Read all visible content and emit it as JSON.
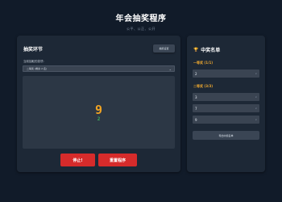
{
  "header": {
    "title": "年会抽奖程序",
    "subtitle": "公平、公正、公开"
  },
  "lottery": {
    "title": "抽奖环节",
    "settings_label": "抽奖设置",
    "prize_field_label": "当前抽取的奖项:",
    "prize_selected": "二等奖 (剩余 2 名)",
    "rolling_number": "9",
    "previous_number": "2",
    "stop_label": "停止!",
    "reset_label": "重置程序"
  },
  "winners": {
    "title": "中奖名单",
    "icon": "trophy-icon",
    "groups": [
      {
        "name": "一等奖 (1/1)",
        "entries": [
          "2"
        ]
      },
      {
        "name": "二等奖 (3/3)",
        "entries": [
          "3",
          "7",
          "9"
        ]
      }
    ],
    "remove_glyph": "×",
    "export_label": "导出中奖名单"
  },
  "colors": {
    "background": "#111b29",
    "panel": "#1d2836",
    "accent_red": "#d62b2b",
    "accent_gold": "#f0a323",
    "accent_green": "#3fae5c"
  }
}
